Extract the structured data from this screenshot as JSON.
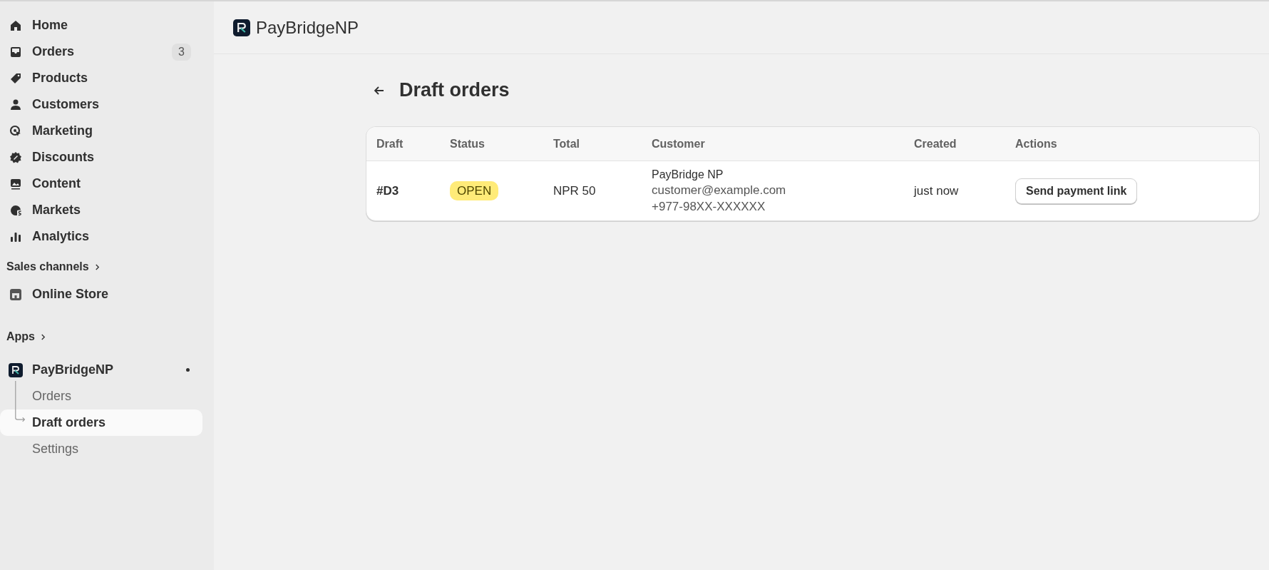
{
  "sidebar": {
    "nav": [
      {
        "label": "Home",
        "selected": false
      },
      {
        "label": "Orders",
        "selected": false,
        "badge": "3"
      },
      {
        "label": "Products",
        "selected": false
      },
      {
        "label": "Customers",
        "selected": false
      },
      {
        "label": "Marketing",
        "selected": false
      },
      {
        "label": "Discounts",
        "selected": false
      },
      {
        "label": "Content",
        "selected": false
      },
      {
        "label": "Markets",
        "selected": false
      },
      {
        "label": "Analytics",
        "selected": false
      }
    ],
    "sales_channels": {
      "heading": "Sales channels",
      "items": [
        {
          "label": "Online Store"
        }
      ]
    },
    "apps": {
      "heading": "Apps",
      "app": {
        "label": "PayBridgeNP",
        "pinned": true,
        "children": [
          {
            "label": "Orders",
            "selected": false
          },
          {
            "label": "Draft orders",
            "selected": true
          },
          {
            "label": "Settings",
            "selected": false
          }
        ]
      }
    }
  },
  "header": {
    "app_name": "PayBridgeNP"
  },
  "page": {
    "title": "Draft orders",
    "table": {
      "columns": [
        "Draft",
        "Status",
        "Total",
        "Customer",
        "Created",
        "Actions"
      ],
      "rows": [
        {
          "draft": "#D3",
          "status": "OPEN",
          "total": "NPR 50",
          "customer": {
            "name": "PayBridge NP",
            "email": "customer@example.com",
            "phone": "+977-98XX-XXXXXX"
          },
          "created": "just now",
          "action": "Send payment link"
        }
      ]
    }
  }
}
